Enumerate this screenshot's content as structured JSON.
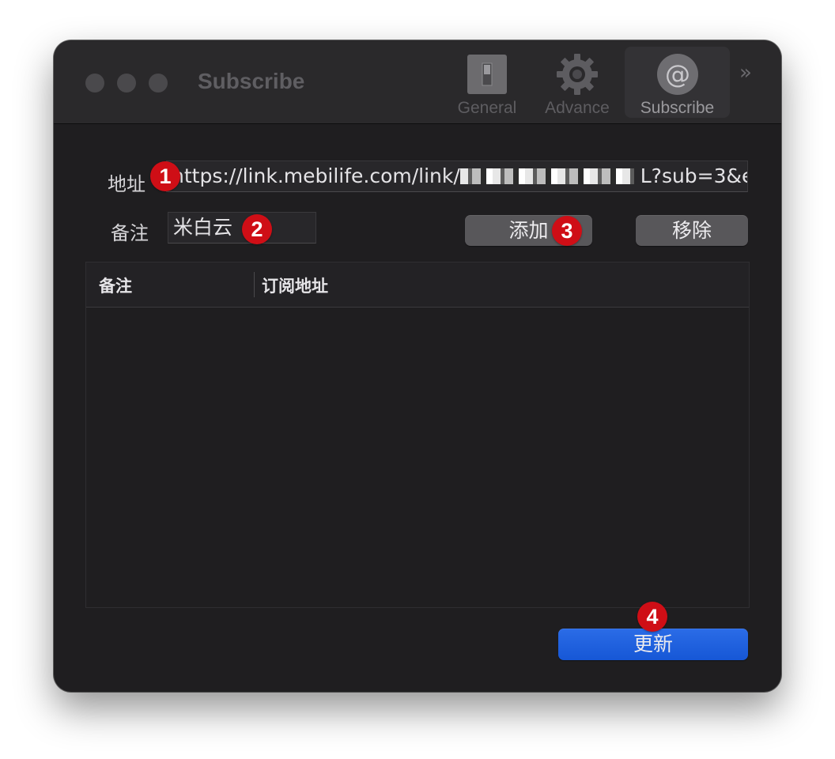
{
  "window": {
    "title": "Subscribe"
  },
  "toolbar": {
    "items": [
      {
        "label": "General",
        "icon": "toggle-switch-icon"
      },
      {
        "label": "Advance",
        "icon": "gear-icon"
      },
      {
        "label": "Subscribe",
        "icon": "at-sign-icon",
        "active": true
      }
    ],
    "overflow": "»",
    "at_glyph": "@"
  },
  "form": {
    "address_label": "地址",
    "address_value_prefix": "https://link.mebilife.com/link/",
    "address_value_suffix": " L?sub=3&e",
    "note_label": "备注",
    "note_value": "米白云",
    "add_button": "添加",
    "remove_button": "移除"
  },
  "table": {
    "columns": [
      "备注",
      "订阅地址"
    ],
    "rows": []
  },
  "update_button": "更新",
  "annotations": [
    "1",
    "2",
    "3",
    "4"
  ],
  "colors": {
    "window_bg": "#1f1e20",
    "primary": "#1657d6",
    "badge": "#cf0e16"
  }
}
